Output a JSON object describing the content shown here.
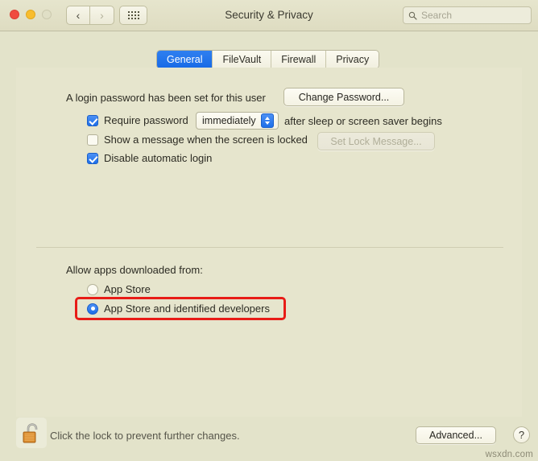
{
  "window": {
    "title": "Security & Privacy",
    "traffic_lights": [
      "close",
      "minimize",
      "zoom"
    ],
    "nav": {
      "back_icon": "chevron-left-icon",
      "forward_icon": "chevron-right-icon",
      "grid_icon": "show-all-grid-icon"
    },
    "search": {
      "placeholder": "Search",
      "value": "",
      "icon": "search-icon"
    }
  },
  "tabs": [
    {
      "label": "General",
      "selected": true
    },
    {
      "label": "FileVault",
      "selected": false
    },
    {
      "label": "Firewall",
      "selected": false
    },
    {
      "label": "Privacy",
      "selected": false
    }
  ],
  "general": {
    "password_status": "A login password has been set for this user",
    "change_password_button": "Change Password...",
    "require_password": {
      "checked": true,
      "label_before": "Require password",
      "popup_value": "immediately",
      "label_after": "after sleep or screen saver begins"
    },
    "show_message": {
      "checked": false,
      "label": "Show a message when the screen is locked",
      "button": "Set Lock Message...",
      "button_disabled": true
    },
    "disable_auto_login": {
      "checked": true,
      "label": "Disable automatic login"
    }
  },
  "gatekeeper": {
    "heading": "Allow apps downloaded from:",
    "options": [
      {
        "label": "App Store",
        "selected": false
      },
      {
        "label": "App Store and identified developers",
        "selected": true
      }
    ],
    "highlight_color": "#e81c17"
  },
  "footer": {
    "lock_icon": "unlocked-padlock-icon",
    "lock_text": "Click the lock to prevent further changes.",
    "advanced_button": "Advanced...",
    "help_button": "?"
  },
  "watermark": "wsxdn.com",
  "colors": {
    "accent": "#1e6fe8",
    "window_background": "#e3e3ca",
    "panel_background": "#e6e5cd",
    "annotation": "#e81c17"
  }
}
